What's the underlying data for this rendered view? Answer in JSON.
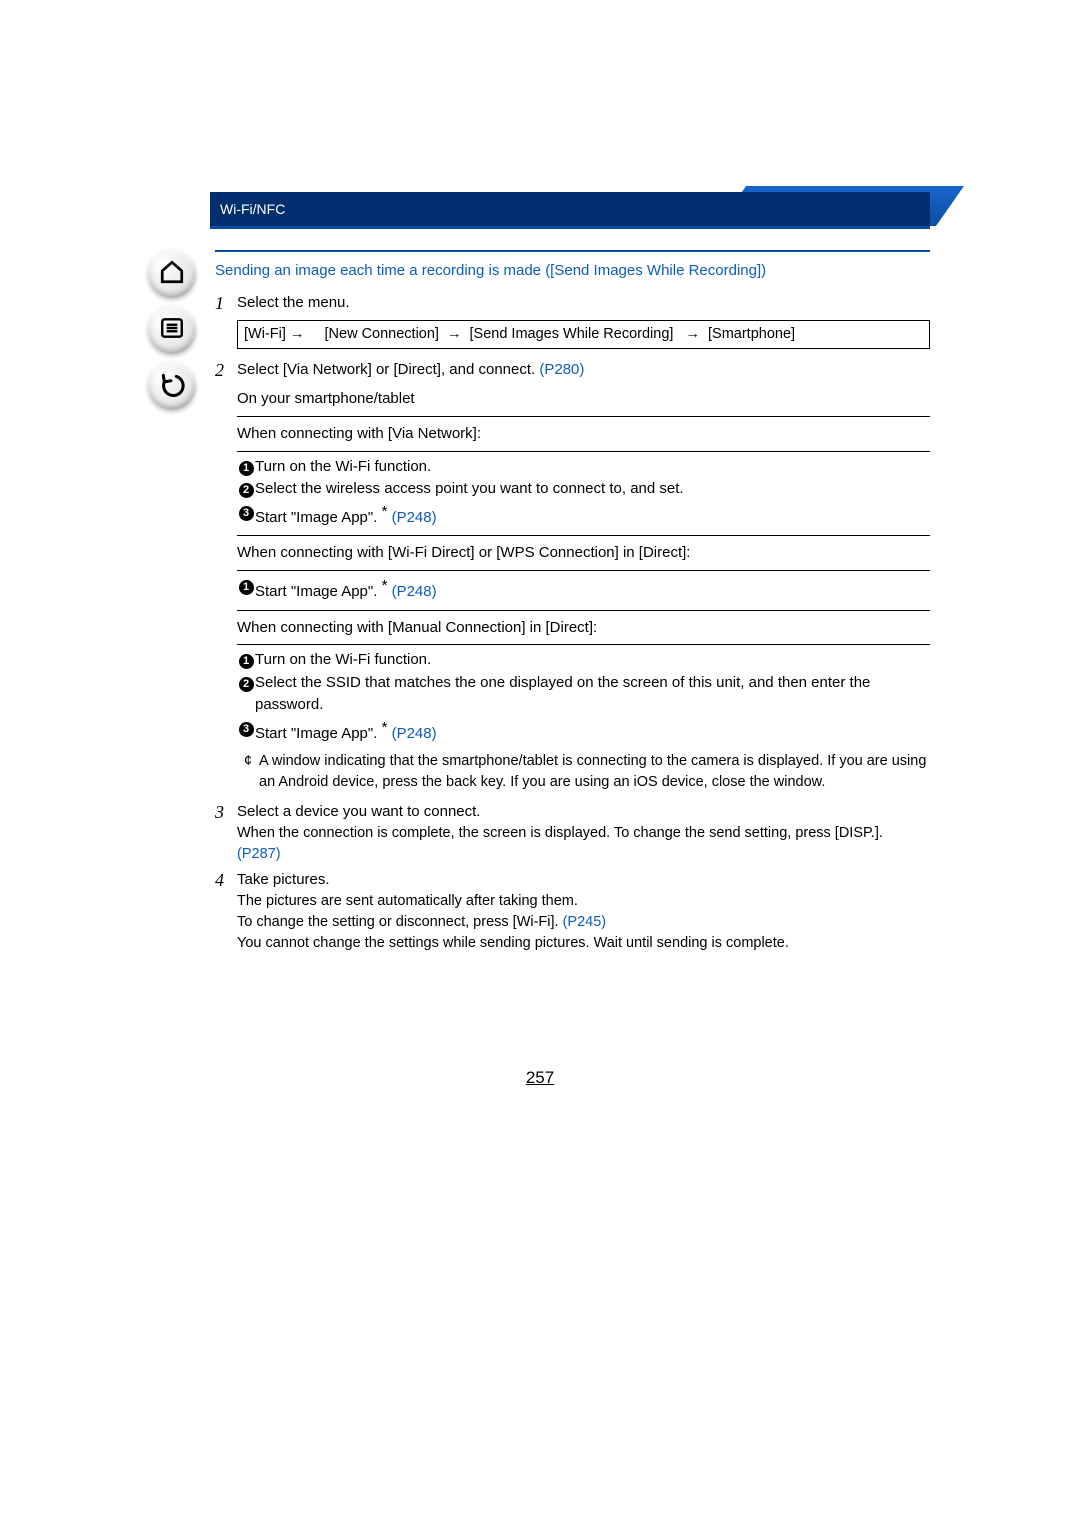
{
  "header": {
    "title": "Wi-Fi/NFC"
  },
  "section_title": "Sending an image each time a recording is made ([Send Images While Recording])",
  "steps": {
    "s1": {
      "num": "1",
      "text": "Select the menu.",
      "menu_path": {
        "a": "[Wi-Fi]",
        "b": "[New Connection]",
        "c": "[Send Images While Recording]",
        "d": "[Smartphone]"
      }
    },
    "s2": {
      "num": "2",
      "text_a": "Select [Via Network] or [Direct], and connect. ",
      "link_a": "(P280)",
      "device_heading": "On your smartphone/tablet",
      "via_network": {
        "heading": "When connecting with [Via Network]:",
        "b1": "Turn on the Wi-Fi function.",
        "b2": "Select the wireless access point you want to connect to, and set.",
        "b3_a": "Start \"Image App\". ",
        "b3_link": "(P248)"
      },
      "wifi_direct": {
        "heading": "When connecting with [Wi-Fi Direct] or [WPS Connection] in [Direct]:",
        "b1_a": "Start \"Image App\". ",
        "b1_link": "(P248)"
      },
      "manual": {
        "heading": "When connecting with [Manual Connection] in [Direct]:",
        "b1": "Turn on the Wi-Fi function.",
        "b2": "Select the SSID that matches the one displayed on the screen of this unit, and then enter the password.",
        "b3_a": "Start \"Image App\". ",
        "b3_link": "(P248)"
      },
      "note": "A window indicating that the smartphone/tablet is connecting to the camera is displayed. If you are using an Android device, press the back key. If you are using an iOS device, close the window."
    },
    "s3": {
      "num": "3",
      "text": "Select a device you want to connect.",
      "sub_a": "When the connection is complete, the screen is displayed. To change the send setting, press [DISP.]. ",
      "sub_link": "(P287)"
    },
    "s4": {
      "num": "4",
      "text": "Take pictures.",
      "sub_a": "The pictures are sent automatically after taking them.",
      "sub_b": "To change the setting or disconnect, press [Wi-Fi]. ",
      "sub_b_link": "(P245)",
      "sub_c": "You cannot change the settings while sending pictures. Wait until sending is complete."
    }
  },
  "sidebar": {
    "home": "home-icon",
    "menu": "list-icon",
    "back": "back-icon"
  },
  "page_number": "257",
  "asterisk_sup": "*",
  "asterisk_note_mark": "¢"
}
